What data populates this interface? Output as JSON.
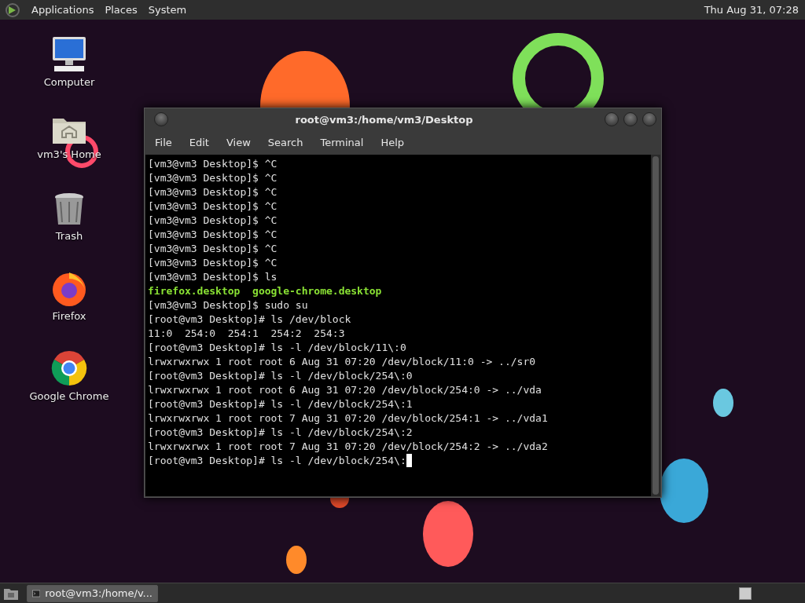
{
  "top_panel": {
    "menus": [
      "Applications",
      "Places",
      "System"
    ],
    "clock": "Thu Aug 31, 07:28"
  },
  "desktop_icons": [
    {
      "kind": "computer",
      "label": "Computer"
    },
    {
      "kind": "home",
      "label": "vm3's Home"
    },
    {
      "kind": "trash",
      "label": "Trash"
    },
    {
      "kind": "firefox",
      "label": "Firefox"
    },
    {
      "kind": "chrome",
      "label": "Google Chrome"
    }
  ],
  "terminal": {
    "title": "root@vm3:/home/vm3/Desktop",
    "menu": [
      "File",
      "Edit",
      "View",
      "Search",
      "Terminal",
      "Help"
    ],
    "cursor": true,
    "lines": [
      {
        "kind": "text",
        "text": "[vm3@vm3 Desktop]$ ^C"
      },
      {
        "kind": "text",
        "text": "[vm3@vm3 Desktop]$ ^C"
      },
      {
        "kind": "text",
        "text": "[vm3@vm3 Desktop]$ ^C"
      },
      {
        "kind": "text",
        "text": "[vm3@vm3 Desktop]$ ^C"
      },
      {
        "kind": "text",
        "text": "[vm3@vm3 Desktop]$ ^C"
      },
      {
        "kind": "text",
        "text": "[vm3@vm3 Desktop]$ ^C"
      },
      {
        "kind": "text",
        "text": "[vm3@vm3 Desktop]$ ^C"
      },
      {
        "kind": "text",
        "text": "[vm3@vm3 Desktop]$ ^C"
      },
      {
        "kind": "text",
        "text": "[vm3@vm3 Desktop]$ ls"
      },
      {
        "kind": "listing",
        "text": "firefox.desktop  google-chrome.desktop"
      },
      {
        "kind": "text",
        "text": "[vm3@vm3 Desktop]$ sudo su"
      },
      {
        "kind": "text",
        "text": "[root@vm3 Desktop]# ls /dev/block"
      },
      {
        "kind": "text",
        "text": "11:0  254:0  254:1  254:2  254:3"
      },
      {
        "kind": "text",
        "text": "[root@vm3 Desktop]# ls -l /dev/block/11\\:0"
      },
      {
        "kind": "text",
        "text": "lrwxrwxrwx 1 root root 6 Aug 31 07:20 /dev/block/11:0 -> ../sr0"
      },
      {
        "kind": "text",
        "text": "[root@vm3 Desktop]# ls -l /dev/block/254\\:0"
      },
      {
        "kind": "text",
        "text": "lrwxrwxrwx 1 root root 6 Aug 31 07:20 /dev/block/254:0 -> ../vda"
      },
      {
        "kind": "text",
        "text": "[root@vm3 Desktop]# ls -l /dev/block/254\\:1"
      },
      {
        "kind": "text",
        "text": "lrwxrwxrwx 1 root root 7 Aug 31 07:20 /dev/block/254:1 -> ../vda1"
      },
      {
        "kind": "text",
        "text": "[root@vm3 Desktop]# ls -l /dev/block/254\\:2"
      },
      {
        "kind": "text",
        "text": "lrwxrwxrwx 1 root root 7 Aug 31 07:20 /dev/block/254:2 -> ../vda2"
      },
      {
        "kind": "text",
        "text": "[root@vm3 Desktop]# ls -l /dev/block/254\\:"
      }
    ]
  },
  "taskbar": {
    "tasks": [
      {
        "label": "root@vm3:/home/v...",
        "selected": true
      }
    ]
  }
}
